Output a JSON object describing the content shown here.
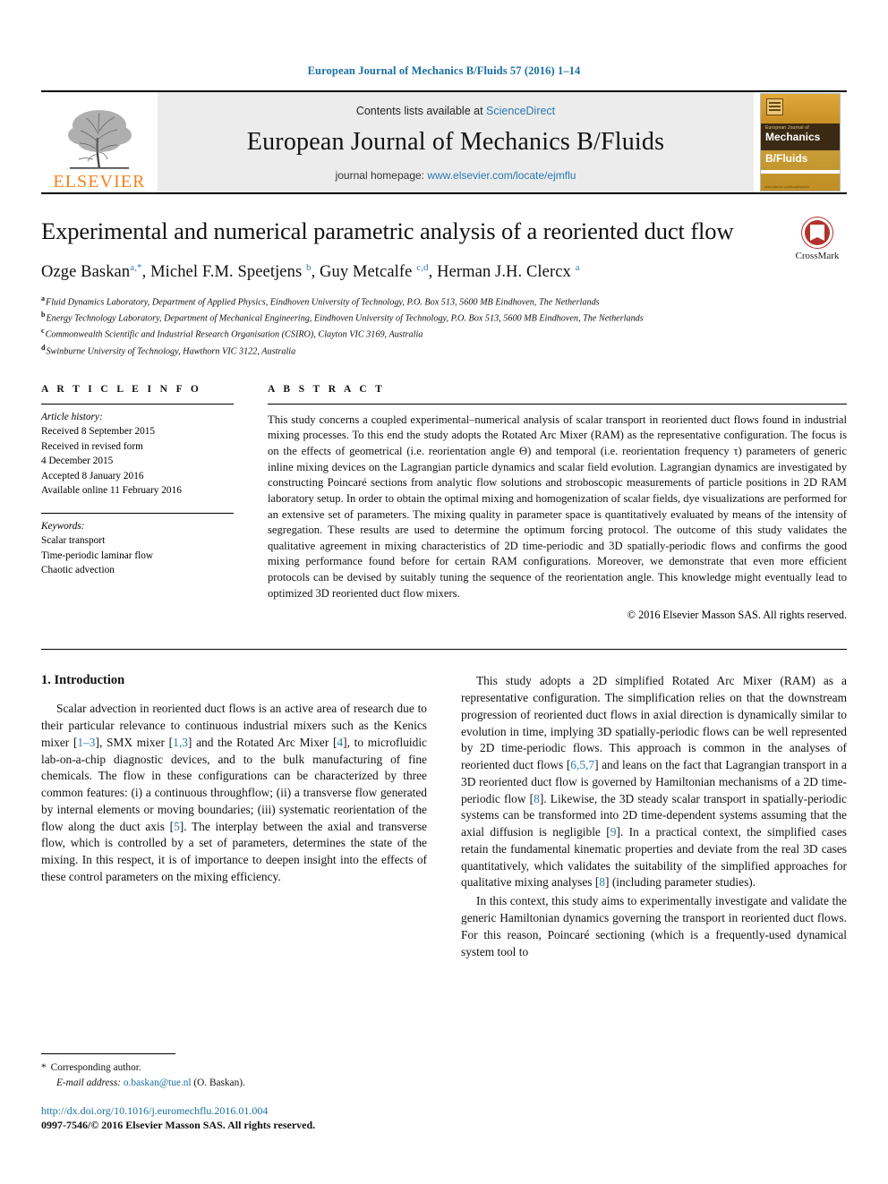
{
  "running_head": "European Journal of Mechanics B/Fluids 57 (2016) 1–14",
  "masthead": {
    "publisher_name": "ELSEVIER",
    "contents_prefix": "Contents lists available at",
    "contents_link": "ScienceDirect",
    "journal_title": "European Journal of Mechanics B/Fluids",
    "homepage_prefix": "journal homepage:",
    "homepage_url": "www.elsevier.com/locate/ejmflu",
    "cover": {
      "line1": "European Journal of",
      "line2": "Mechanics",
      "line3": "B/Fluids",
      "footer": "www.elsevier.com/locate/ejmflu"
    }
  },
  "crossmark": {
    "label": "CrossMark"
  },
  "article": {
    "title": "Experimental and numerical parametric analysis of a reoriented duct flow",
    "authors_html": "Ozge Baskan<sup>a,*</sup>, Michel F.M. Speetjens <sup>b</sup>, Guy Metcalfe <sup>c,d</sup>, Herman J.H. Clercx <sup>a</sup>",
    "authors_plain": "Ozge Baskan a,*, Michel F.M. Speetjens b, Guy Metcalfe c,d, Herman J.H. Clercx a",
    "affiliations": [
      {
        "mark": "a",
        "text": "Fluid Dynamics Laboratory, Department of Applied Physics, Eindhoven University of Technology, P.O. Box 513, 5600 MB Eindhoven, The Netherlands"
      },
      {
        "mark": "b",
        "text": "Energy Technology Laboratory, Department of Mechanical Engineering, Eindhoven University of Technology, P.O. Box 513, 5600 MB Eindhoven, The Netherlands"
      },
      {
        "mark": "c",
        "text": "Commonwealth Scientific and Industrial Research Organisation (CSIRO), Clayton VIC 3169, Australia"
      },
      {
        "mark": "d",
        "text": "Swinburne University of Technology, Hawthorn VIC 3122, Australia"
      }
    ]
  },
  "article_info": {
    "heading": "A R T I C L E   I N F O",
    "history_label": "Article history:",
    "history": [
      "Received 8 September 2015",
      "Received in revised form",
      "4 December 2015",
      "Accepted 8 January 2016",
      "Available online 11 February 2016"
    ],
    "keywords_label": "Keywords:",
    "keywords": [
      "Scalar transport",
      "Time-periodic laminar flow",
      "Chaotic advection"
    ]
  },
  "abstract": {
    "heading": "A B S T R A C T",
    "text": "This study concerns a coupled experimental–numerical analysis of scalar transport in reoriented duct flows found in industrial mixing processes. To this end the study adopts the Rotated Arc Mixer (RAM) as the representative configuration. The focus is on the effects of geometrical (i.e. reorientation angle Θ) and temporal (i.e. reorientation frequency τ) parameters of generic inline mixing devices on the Lagrangian particle dynamics and scalar field evolution. Lagrangian dynamics are investigated by constructing Poincaré sections from analytic flow solutions and stroboscopic measurements of particle positions in 2D RAM laboratory setup. In order to obtain the optimal mixing and homogenization of scalar fields, dye visualizations are performed for an extensive set of parameters. The mixing quality in parameter space is quantitatively evaluated by means of the intensity of segregation. These results are used to determine the optimum forcing protocol. The outcome of this study validates the qualitative agreement in mixing characteristics of 2D time-periodic and 3D spatially-periodic flows and confirms the good mixing performance found before for certain RAM configurations. Moreover, we demonstrate that even more efficient protocols can be devised by suitably tuning the sequence of the reorientation angle. This knowledge might eventually lead to optimized 3D reoriented duct flow mixers.",
    "copyright": "© 2016 Elsevier Masson SAS. All rights reserved."
  },
  "body": {
    "section_heading": "1. Introduction",
    "left_paragraphs": [
      "Scalar advection in reoriented duct flows is an active area of research due to their particular relevance to continuous industrial mixers such as the Kenics mixer [1–3], SMX mixer [1,3] and the Rotated Arc Mixer [4], to microfluidic lab-on-a-chip diagnostic devices, and to the bulk manufacturing of fine chemicals. The flow in these configurations can be characterized by three common features: (i) a continuous throughflow; (ii) a transverse flow generated by internal elements or moving boundaries; (iii) systematic reorientation of the flow along the duct axis [5]. The interplay between the axial and transverse flow, which is controlled by a set of parameters, determines the state of the mixing. In this respect, it is of importance to deepen insight into the effects of these control parameters on the mixing efficiency."
    ],
    "right_paragraphs": [
      "This study adopts a 2D simplified Rotated Arc Mixer (RAM) as a representative configuration. The simplification relies on that the downstream progression of reoriented duct flows in axial direction is dynamically similar to evolution in time, implying 3D spatially-periodic flows can be well represented by 2D time-periodic flows. This approach is common in the analyses of reoriented duct flows [6,5,7] and leans on the fact that Lagrangian transport in a 3D reoriented duct flow is governed by Hamiltonian mechanisms of a 2D time-periodic flow [8]. Likewise, the 3D steady scalar transport in spatially-periodic systems can be transformed into 2D time-dependent systems assuming that the axial diffusion is negligible [9]. In a practical context, the simplified cases retain the fundamental kinematic properties and deviate from the real 3D cases quantitatively, which validates the suitability of the simplified approaches for qualitative mixing analyses [8] (including parameter studies).",
      "In this context, this study aims to experimentally investigate and validate the generic Hamiltonian dynamics governing the transport in reoriented duct flows. For this reason, Poincaré sectioning (which is a frequently-used dynamical system tool to"
    ]
  },
  "footnote": {
    "star": "*",
    "corresponding": "Corresponding author.",
    "email_label": "E-mail address:",
    "email": "o.baskan@tue.nl",
    "email_suffix": "(O. Baskan).",
    "doi_url": "http://dx.doi.org/10.1016/j.euromechflu.2016.01.004",
    "issn_line": "0997-7546/© 2016 Elsevier Masson SAS. All rights reserved."
  },
  "colors": {
    "link": "#2a7ab0",
    "running_head": "#1a6fa3",
    "elsevier_orange": "#f58220",
    "crossmark_red": "#b3322c"
  }
}
